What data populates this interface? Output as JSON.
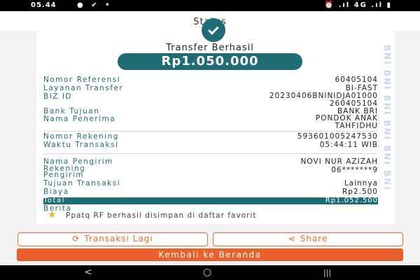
{
  "status_bar": {
    "time": "05.44",
    "left_icons": "● ✔ •",
    "right_icons": "⏰ .ıl 4G .ıl ▮"
  },
  "header": {
    "title": "Status"
  },
  "watermark": "BNI BNI BNI BNI BNI BNI",
  "receipt": {
    "headline": "Transfer Berhasil",
    "amount": "Rp1.050.000",
    "details": [
      {
        "label": "Nomor Referensi",
        "value": "60405104"
      },
      {
        "label": "Layanan Transfer",
        "value": "BI-FAST"
      },
      {
        "label": "BIZ ID",
        "value": "20230406BNINIDJA01000\n260405104"
      },
      {
        "label": "Bank Tujuan",
        "value": "BANK BRI"
      },
      {
        "label": "Nama Penerima",
        "value": "PONDOK ANAK\nTAHFIDHU"
      },
      {
        "label": "Nomor Rekening",
        "value": "593601005247530"
      },
      {
        "label": "Waktu Transaksi",
        "value": "05:44:11 WIB"
      },
      {
        "label": "Nama Pengirim",
        "value": "NOVI NUR AZIZAH"
      },
      {
        "label": "Rekening Pengirim",
        "value": "06*******9"
      },
      {
        "label": "Tujuan Transaksi",
        "value": "Lainnya"
      },
      {
        "label": "Biaya",
        "value": "Rp2.500"
      }
    ],
    "total": {
      "label": "Total",
      "value": "Rp1.052.500"
    },
    "berita_label": "Berita",
    "favorite_message": "Ppatq RF berhasil disimpan di daftar favorit"
  },
  "actions": {
    "repeat_label": "Transaksi Lagi",
    "share_label": "Share",
    "home_label": "Kembali ke Beranda"
  },
  "nav": {
    "back": "<",
    "home": "○",
    "recent": "|||"
  },
  "colors": {
    "teal": "#1f6c75",
    "orange": "#e9602a"
  }
}
